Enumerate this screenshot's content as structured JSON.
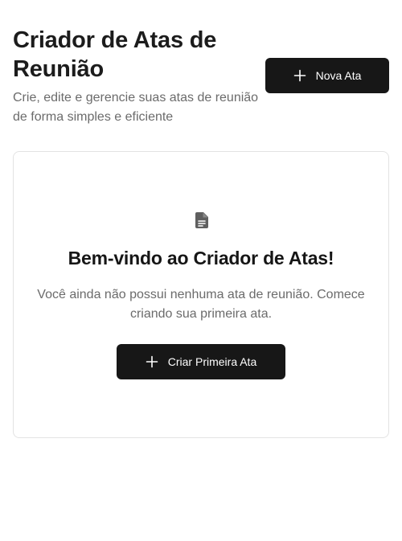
{
  "header": {
    "title": "Criador de Atas de Reunião",
    "subtitle": "Crie, edite e gerencie suas atas de reunião de forma simples e eficiente",
    "new_button_label": "Nova Ata",
    "new_button_icon": "plus-icon"
  },
  "empty_state": {
    "icon": "document-icon",
    "title": "Bem-vindo ao Criador de Atas!",
    "description": "Você ainda não possui nenhuma ata de reunião. Comece criando sua primeira ata.",
    "button_label": "Criar Primeira Ata",
    "button_icon": "plus-icon"
  },
  "colors": {
    "primary_button": "#171717",
    "muted_text": "#6b6b6b",
    "card_border": "#e3e3e3"
  }
}
